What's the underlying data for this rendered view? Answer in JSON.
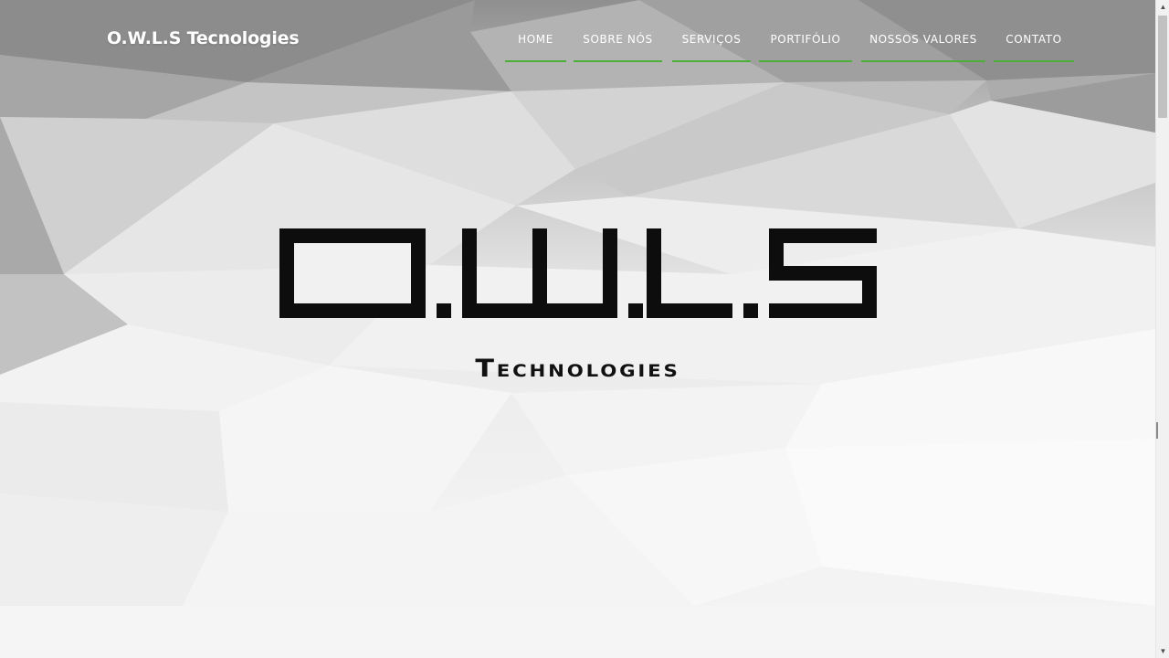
{
  "brand": {
    "name": "O.W.L.S Tecnologies"
  },
  "nav": {
    "items": [
      {
        "label": "HOME"
      },
      {
        "label": "SOBRE NÓS"
      },
      {
        "label": "SERVIÇOS"
      },
      {
        "label": "PORTIFÓLIO"
      },
      {
        "label": "NOSSOS VALORES"
      },
      {
        "label": "CONTATO"
      }
    ]
  },
  "hero": {
    "logo_text": "O.W.L.S",
    "subtitle": "Technologies"
  },
  "colors": {
    "nav_underline": "#4caf3a",
    "logo": "#0d0d0d",
    "nav_text": "#ffffff"
  },
  "icons": {
    "scroll_up": "triangle-up",
    "scroll_down": "triangle-down"
  }
}
